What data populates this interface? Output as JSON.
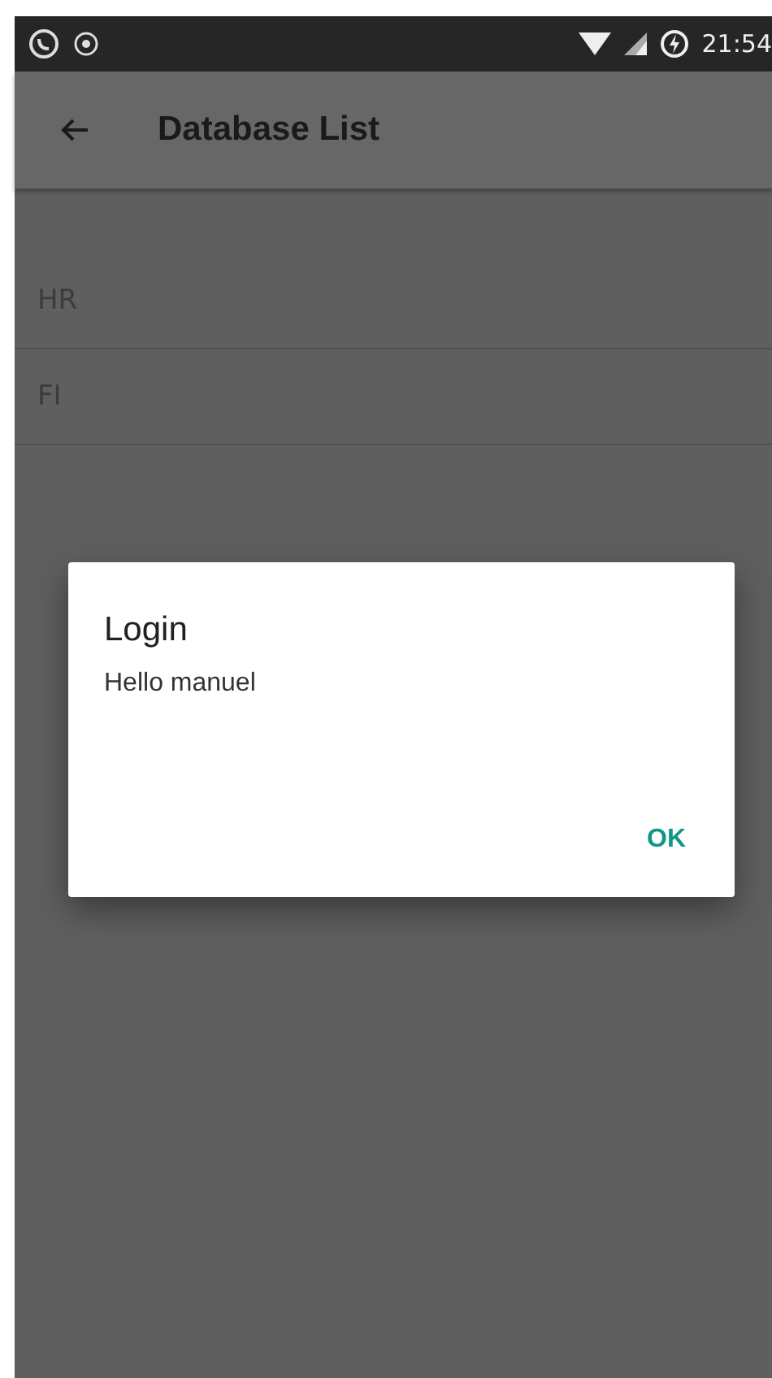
{
  "status_bar": {
    "time": "21:54"
  },
  "app_bar": {
    "title": "Database List"
  },
  "list": [
    {
      "label": "HR"
    },
    {
      "label": "FI"
    }
  ],
  "dialog": {
    "title": "Login",
    "message": "Hello manuel",
    "buttons": [
      "OK"
    ]
  }
}
